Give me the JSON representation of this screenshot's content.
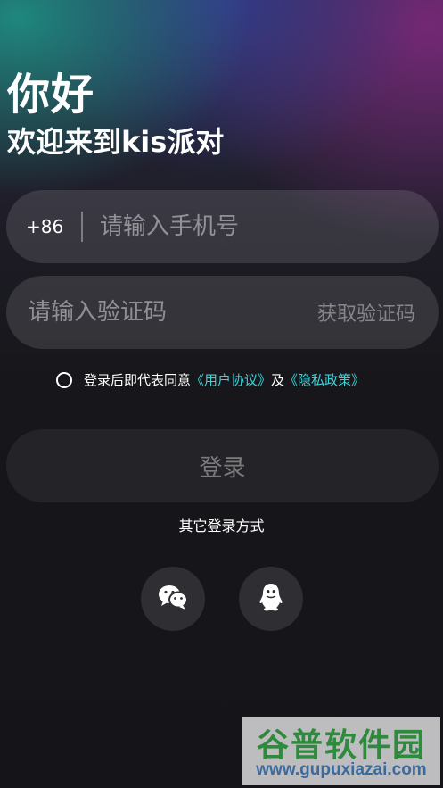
{
  "header": {
    "greeting": "你好",
    "welcome": "欢迎来到kis派对"
  },
  "phone": {
    "prefix": "+86",
    "placeholder": "请输入手机号"
  },
  "code": {
    "placeholder": "请输入验证码",
    "get_code": "获取验证码"
  },
  "agreement": {
    "text": "登录后即代表同意",
    "user_agreement": "《用户协议》",
    "and": "及",
    "privacy_policy": "《隐私政策》",
    "link_color": "#38d3d8"
  },
  "login": {
    "label": "登录"
  },
  "other_login": {
    "label": "其它登录方式",
    "methods": [
      {
        "icon": "wechat-icon"
      },
      {
        "icon": "qq-icon"
      }
    ]
  },
  "watermark": {
    "title": "谷普软件园",
    "url": "www.gupuxiazai.com"
  }
}
